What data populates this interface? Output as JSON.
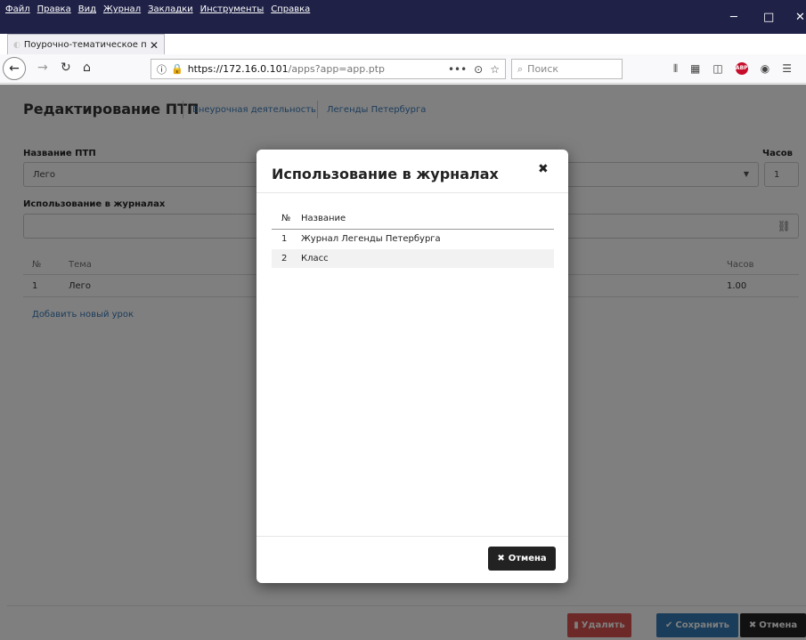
{
  "browser": {
    "menu": [
      "Файл",
      "Правка",
      "Вид",
      "Журнал",
      "Закладки",
      "Инструменты",
      "Справка"
    ],
    "tab_title": "Поурочно-тематическое пла",
    "url_host": "https://172.16.0.101",
    "url_path": "/apps?app=app.ptp",
    "search_placeholder": "Поиск"
  },
  "page": {
    "title": "Редактирование ПТП",
    "breadcrumbs": [
      "Внеурочная деятельность",
      "Легенды Петербурга"
    ],
    "name_label": "Название ПТП",
    "name_value": "Лего",
    "hours_label": "Часов",
    "hours_value": "1",
    "usage_label": "Использование в журналах",
    "table": {
      "headers": [
        "№",
        "Тема",
        "Часов"
      ],
      "rows": [
        {
          "n": "1",
          "topic": "Лего",
          "hours": "1.00"
        }
      ]
    },
    "add_lesson": "Добавить новый урок",
    "buttons": {
      "delete": "Удалить",
      "save": "Сохранить",
      "cancel": "Отмена"
    }
  },
  "modal": {
    "title": "Использование в журналах",
    "headers": [
      "№",
      "Название"
    ],
    "rows": [
      {
        "n": "1",
        "name": "Журнал Легенды Петербурга"
      },
      {
        "n": "2",
        "name": "Класс"
      }
    ],
    "cancel": "Отмена"
  },
  "colors": {
    "danger": "#d9534f",
    "primary": "#337ab7",
    "dark": "#222222"
  }
}
